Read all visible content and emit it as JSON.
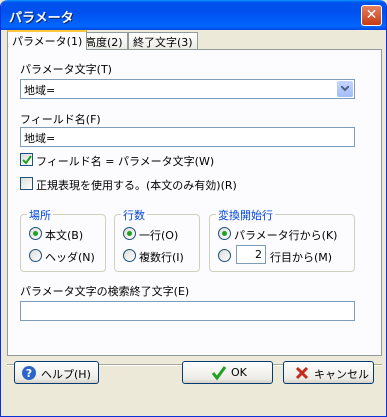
{
  "window": {
    "title": "パラメータ",
    "close_glyph": "✕"
  },
  "tabs": [
    {
      "label": "パラメータ(1)",
      "active": true
    },
    {
      "label": "高度(2)",
      "active": false
    },
    {
      "label": "終了文字(3)",
      "active": false
    }
  ],
  "param_string": {
    "label": "パラメータ文字(T)",
    "value": "地域="
  },
  "field_name": {
    "label": "フィールド名(F)",
    "value": "地域="
  },
  "checkbox_same": {
    "label": "フィールド名 = パラメータ文字(W)",
    "checked": true
  },
  "checkbox_regex": {
    "label": "正規表現を使用する。(本文のみ有効)(R)",
    "checked": false
  },
  "group_location": {
    "title": "場所",
    "options": [
      {
        "label": "本文(B)",
        "selected": true
      },
      {
        "label": "ヘッダ(N)",
        "selected": false
      }
    ]
  },
  "group_lines": {
    "title": "行数",
    "options": [
      {
        "label": "一行(O)",
        "selected": true
      },
      {
        "label": "複数行(I)",
        "selected": false
      }
    ]
  },
  "group_start": {
    "title": "変換開始行",
    "options": [
      {
        "label": "パラメータ行から(K)",
        "selected": true
      },
      {
        "label": "行目から(M)",
        "selected": false
      }
    ],
    "line_value": "2"
  },
  "search_end": {
    "label": "パラメータ文字の検索終了文字(E)",
    "value": ""
  },
  "buttons": {
    "help": "ヘルプ(H)",
    "ok": "OK",
    "cancel": "キャンセル"
  },
  "colors": {
    "group_title": "#0046d5",
    "titlebar": "#0053ee",
    "check": "#21a121"
  }
}
